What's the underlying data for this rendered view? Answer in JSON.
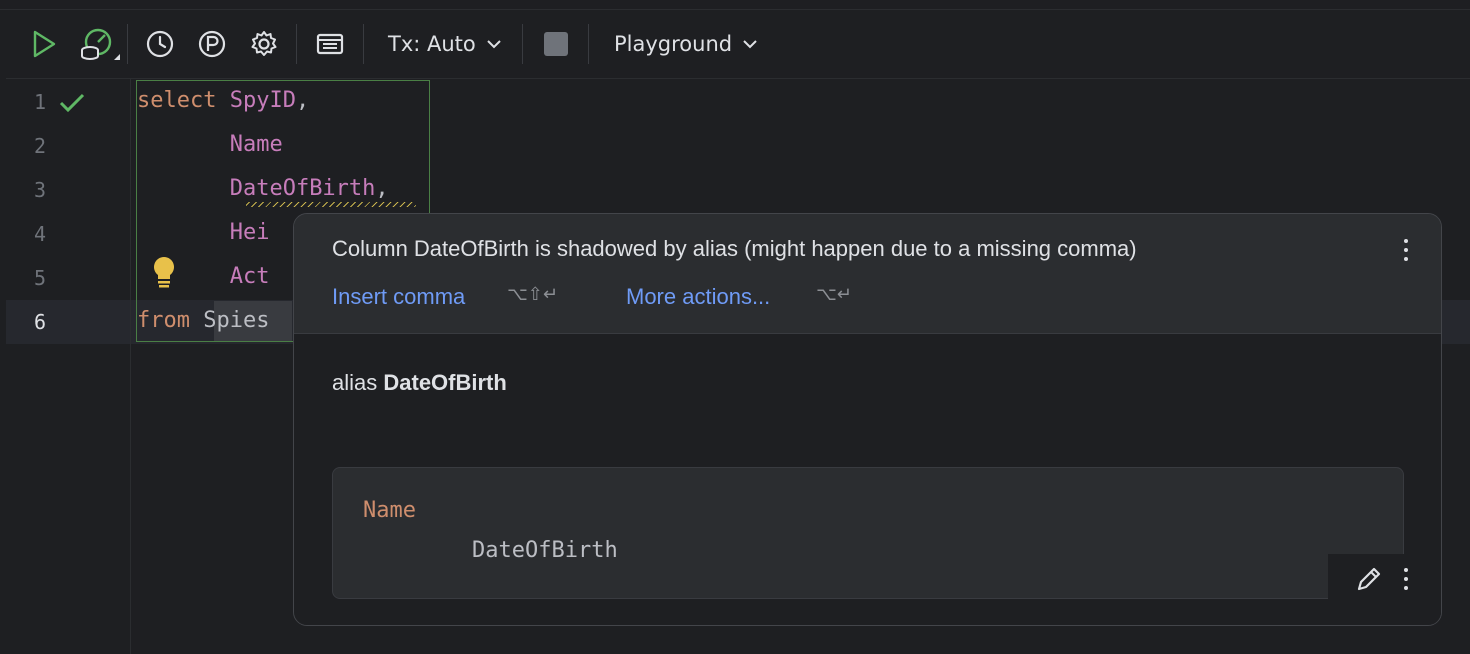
{
  "toolbar": {
    "tx_label": "Tx: Auto",
    "target_label": "Playground"
  },
  "editor": {
    "line_numbers": [
      "1",
      "2",
      "3",
      "4",
      "5",
      "6"
    ],
    "lines": [
      [
        {
          "t": "select",
          "c": "kw"
        },
        {
          "t": " ",
          "c": "plain"
        },
        {
          "t": "SpyID",
          "c": "col"
        },
        {
          "t": ",",
          "c": "punc"
        }
      ],
      [
        {
          "t": "       ",
          "c": "plain"
        },
        {
          "t": "Name",
          "c": "col"
        }
      ],
      [
        {
          "t": "       ",
          "c": "plain"
        },
        {
          "t": "DateOfBirth",
          "c": "col"
        },
        {
          "t": ",",
          "c": "punc"
        }
      ],
      [
        {
          "t": "       ",
          "c": "plain"
        },
        {
          "t": "Hei",
          "c": "col"
        }
      ],
      [
        {
          "t": "       ",
          "c": "plain"
        },
        {
          "t": "Act",
          "c": "col"
        }
      ],
      [
        {
          "t": "from",
          "c": "kw"
        },
        {
          "t": " ",
          "c": "plain"
        },
        {
          "t": "Spies",
          "c": "plain"
        }
      ]
    ]
  },
  "popup": {
    "message": "Column DateOfBirth is shadowed by alias (might happen due to a missing comma)",
    "action_insert": "Insert comma",
    "action_insert_shortcut": "⌥⇧↵",
    "action_more": "More actions...",
    "action_more_shortcut": "⌥↵",
    "alias_prefix": "alias",
    "alias_name": "DateOfBirth",
    "code_line1": "Name",
    "code_line2": "DateOfBirth"
  },
  "colors": {
    "keyword": "#cf8e6d",
    "column": "#c77dbb",
    "link": "#6f9bf6",
    "success": "#5fb865",
    "warning": "#e8c14a"
  }
}
